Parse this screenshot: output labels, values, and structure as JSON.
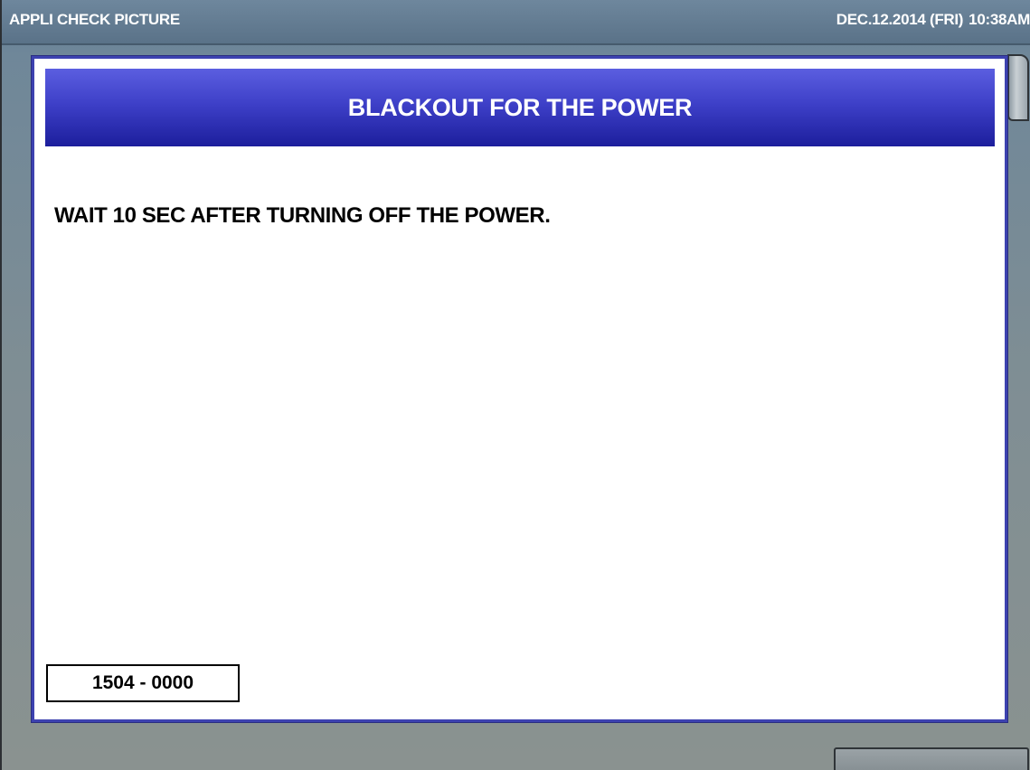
{
  "app": {
    "title": "APPLI CHECK PICTURE",
    "date": "DEC.12.2014 (FRI)",
    "time": "10:38AM"
  },
  "dialog": {
    "title": "BLACKOUT FOR THE POWER",
    "message": "WAIT 10 SEC AFTER TURNING OFF THE POWER.",
    "code": "1504 - 0000"
  },
  "colors": {
    "header_gradient_top": "#5b5ee0",
    "header_gradient_bottom": "#1c1e9c",
    "dialog_border": "#3d42b0",
    "titlebar": "#6e879d"
  }
}
